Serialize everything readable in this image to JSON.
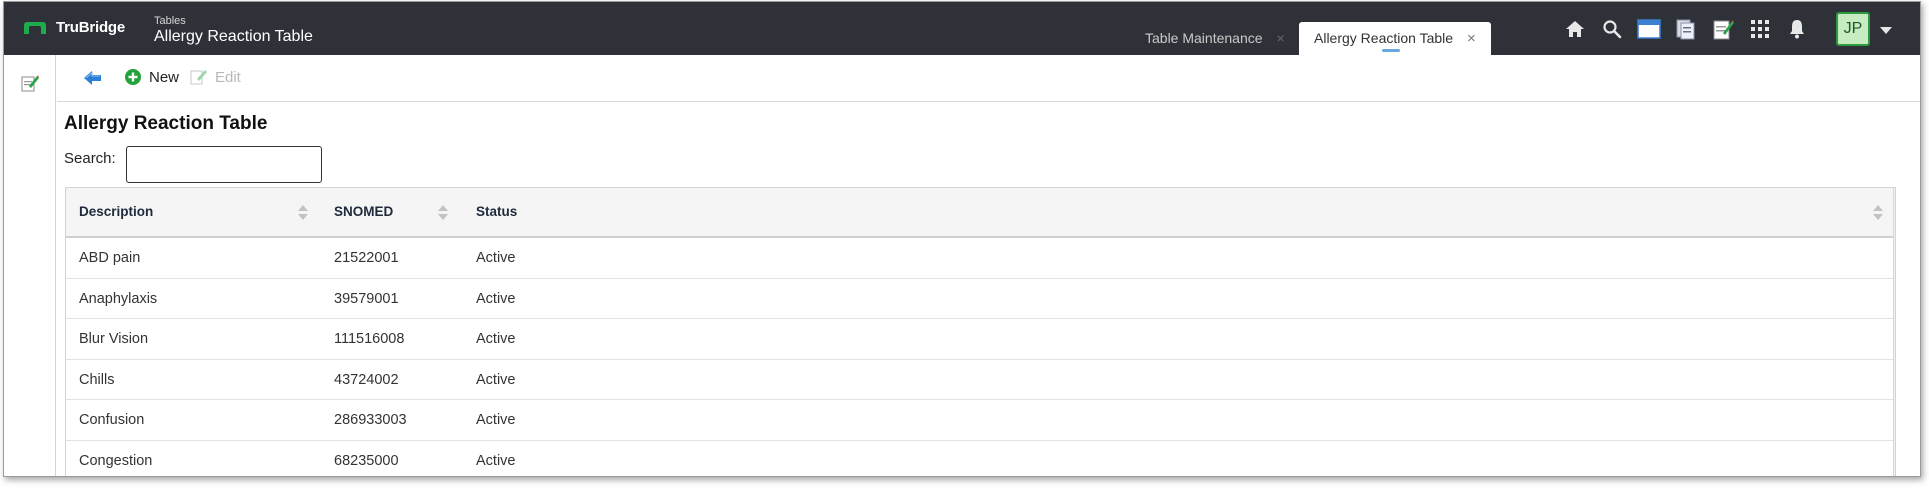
{
  "header": {
    "brand": "TruBridge",
    "breadcrumb_small": "Tables",
    "breadcrumb_title": "Allergy Reaction Table",
    "tabs": [
      {
        "label": "Table Maintenance",
        "close": "×"
      },
      {
        "label": "Allergy Reaction Table",
        "close": "×"
      }
    ],
    "icons": [
      "home-icon",
      "search-icon",
      "window-icon",
      "documents-icon",
      "notes-icon",
      "apps-grid-icon",
      "bell-icon"
    ],
    "user_initials": "JP",
    "colors": {
      "bar": "#2e3238",
      "brand": "#1faa4b",
      "avatar_bg": "#c7ecc1"
    }
  },
  "toolbar": {
    "new_label": "New",
    "edit_label": "Edit"
  },
  "main": {
    "title": "Allergy Reaction Table",
    "search_label": "Search:",
    "search_value": ""
  },
  "table": {
    "columns": [
      "Description",
      "SNOMED",
      "Status"
    ],
    "rows": [
      {
        "description": "ABD pain",
        "snomed": "21522001",
        "status": "Active"
      },
      {
        "description": "Anaphylaxis",
        "snomed": "39579001",
        "status": "Active"
      },
      {
        "description": "Blur Vision",
        "snomed": "111516008",
        "status": "Active"
      },
      {
        "description": "Chills",
        "snomed": "43724002",
        "status": "Active"
      },
      {
        "description": "Confusion",
        "snomed": "286933003",
        "status": "Active"
      },
      {
        "description": "Congestion",
        "snomed": "68235000",
        "status": "Active"
      }
    ]
  }
}
